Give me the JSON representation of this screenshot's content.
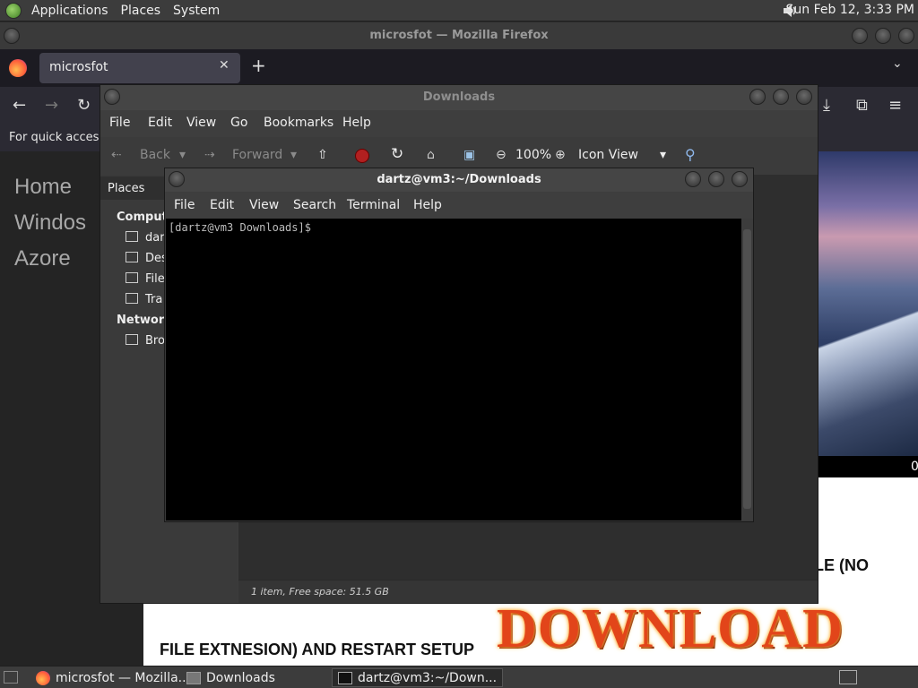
{
  "top_panel": {
    "menus": [
      "Applications",
      "Places",
      "System"
    ],
    "clock": "Sun Feb 12,  3:33 PM"
  },
  "firefox": {
    "window_title": "microsfot — Mozilla Firefox",
    "tab_title": "microsfot",
    "bookmarks_text": "For quick access,",
    "page": {
      "side_links": [
        "Home",
        "Windos",
        "Azore"
      ],
      "hero_strip_text": "0",
      "text_right": "LE (NO",
      "text_bottom": "FILE EXTNESION) AND RESTART SETUP",
      "banner": "DOWNLOAD"
    }
  },
  "nautilus": {
    "title": "Downloads",
    "menus": [
      "File",
      "Edit",
      "View",
      "Go",
      "Bookmarks",
      "Help"
    ],
    "toolbar": {
      "back": "Back",
      "forward": "Forward",
      "zoom": "100%",
      "view_mode": "Icon View"
    },
    "places_label": "Places",
    "sidebar": {
      "computer_heading": "Compute",
      "computer_items": [
        "dar",
        "Des",
        "File",
        "Tra"
      ],
      "network_heading": "Network",
      "network_items": [
        "Bro"
      ]
    },
    "status": "1 item, Free space: 51.5 GB"
  },
  "terminal": {
    "title": "dartz@vm3:~/Downloads",
    "menus": [
      "File",
      "Edit",
      "View",
      "Search",
      "Terminal",
      "Help"
    ],
    "prompt": "[dartz@vm3 Downloads]$"
  },
  "bottom_panel": {
    "tasks": [
      "microsfot — Mozilla...",
      "Downloads",
      "dartz@vm3:~/Down..."
    ]
  }
}
